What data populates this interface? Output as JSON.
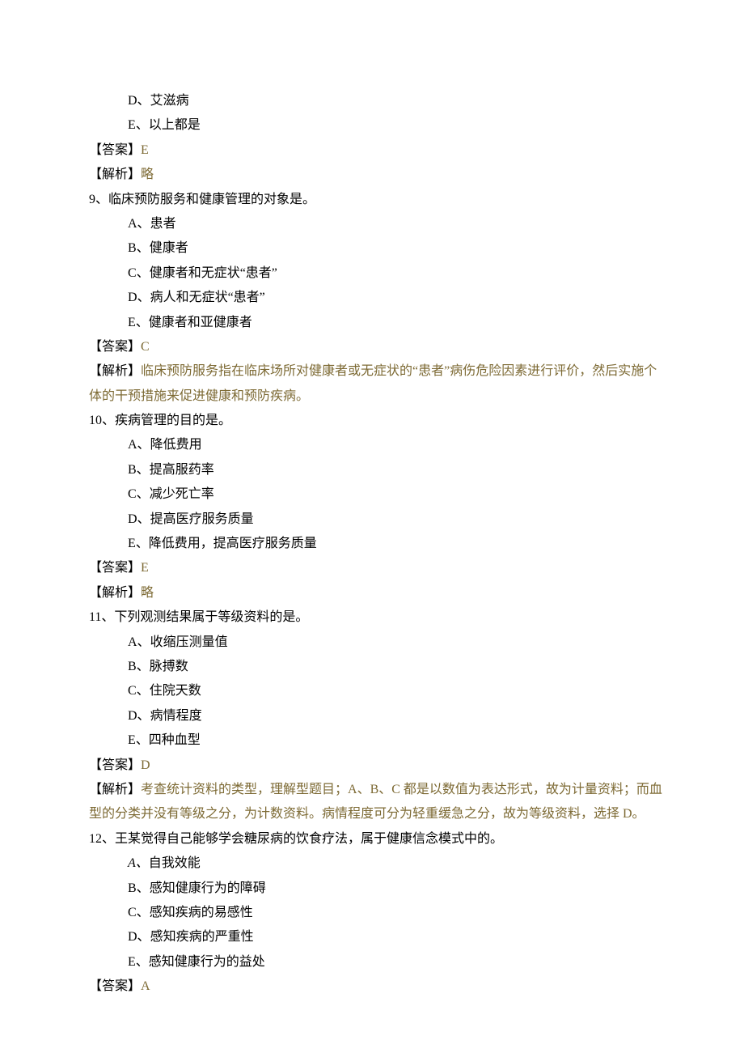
{
  "q8_trail": {
    "opts": [
      {
        "letter": "D、",
        "text": "艾滋病"
      },
      {
        "letter": "E、",
        "text": "以上都是"
      }
    ],
    "ans_label": "【答案】",
    "ans": "E",
    "exp_label": "【解析】",
    "exp": "略"
  },
  "q9": {
    "num": "9、",
    "stem": "临床预防服务和健康管理的对象是。",
    "opts": [
      {
        "letter": "A、",
        "text": "患者"
      },
      {
        "letter": "B、",
        "text": "健康者"
      },
      {
        "letter": "C、",
        "text": "健康者和无症状“患者”"
      },
      {
        "letter": "D、",
        "text": "病人和无症状“患者”"
      },
      {
        "letter": "E、",
        "text": "健康者和亚健康者"
      }
    ],
    "ans_label": "【答案】",
    "ans": "C",
    "exp_label": "【解析】",
    "exp": "临床预防服务指在临床场所对健康者或无症状的“患者”病伤危险因素进行评价，然后实施个体的干预措施来促进健康和预防疾病。"
  },
  "q10": {
    "num": "10、",
    "stem": "疾病管理的目的是。",
    "opts": [
      {
        "letter": "A、",
        "text": "降低费用"
      },
      {
        "letter": "B、",
        "text": "提高服药率"
      },
      {
        "letter": "C、",
        "text": "减少死亡率"
      },
      {
        "letter": "D、",
        "text": "提高医疗服务质量"
      },
      {
        "letter": "E、",
        "text": "降低费用，提高医疗服务质量"
      }
    ],
    "ans_label": "【答案】",
    "ans": "E",
    "exp_label": "【解析】",
    "exp": "略"
  },
  "q11": {
    "num": "11、",
    "stem": "下列观测结果属于等级资料的是。",
    "opts": [
      {
        "letter": "A、",
        "text": "收缩压测量值"
      },
      {
        "letter": "B、",
        "text": "脉搏数"
      },
      {
        "letter": "C、",
        "text": "住院天数"
      },
      {
        "letter": "D、",
        "text": "病情程度"
      },
      {
        "letter": "E、",
        "text": "四种血型"
      }
    ],
    "ans_label": "【答案】",
    "ans": "D",
    "exp_label": "【解析】",
    "exp": "考查统计资料的类型，理解型题目；A、B、C 都是以数值为表达形式，故为计量资料；而血型的分类并没有等级之分，为计数资料。病情程度可分为轻重缓急之分，故为等级资料，选择 D。"
  },
  "q12": {
    "num": "12、",
    "stem": "王某觉得自己能够学会糖尿病的饮食疗法，属于健康信念模式中的。",
    "opts": [
      {
        "letter": "A、",
        "text": "自我效能",
        "italic_letter": true
      },
      {
        "letter": "B、",
        "text": "感知健康行为的障碍"
      },
      {
        "letter": "C、",
        "text": "感知疾病的易感性"
      },
      {
        "letter": "D、",
        "text": "感知疾病的严重性"
      },
      {
        "letter": "E、",
        "text": "感知健康行为的益处"
      }
    ],
    "ans_label": "【答案】",
    "ans": "A"
  }
}
